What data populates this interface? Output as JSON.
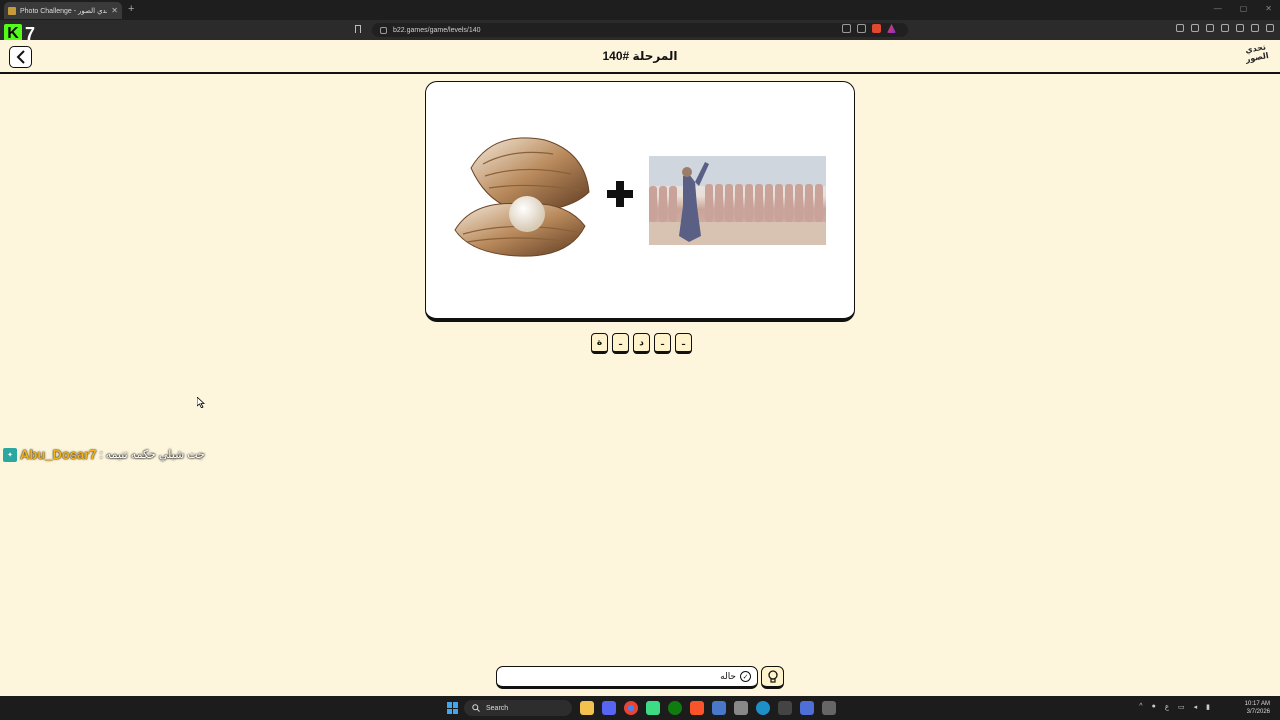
{
  "browser": {
    "tab_title": "Photo Challenge - تحدي الصور",
    "url": "b22.games/game/levels/140"
  },
  "stream_overlay": {
    "viewer_count": "7",
    "chat_user": "Abu_Dosar7",
    "chat_message": "جت شيلي حكمه تنيمه :"
  },
  "game": {
    "level_title": "المرحلة #140",
    "logo_text": "تحدي الصور",
    "images": [
      {
        "icon": "pearl-oyster-image"
      },
      {
        "icon": "group-dance-photo"
      }
    ],
    "plus_symbol": "+",
    "letter_slots": [
      "ـ",
      "ـ",
      "د",
      "ـ",
      "ة"
    ],
    "answer_value": "حاله",
    "answer_check": "✓"
  },
  "taskbar": {
    "search_label": "Search",
    "tray_lang": "ع",
    "time": "10:17 AM",
    "date": "3/7/2026"
  }
}
